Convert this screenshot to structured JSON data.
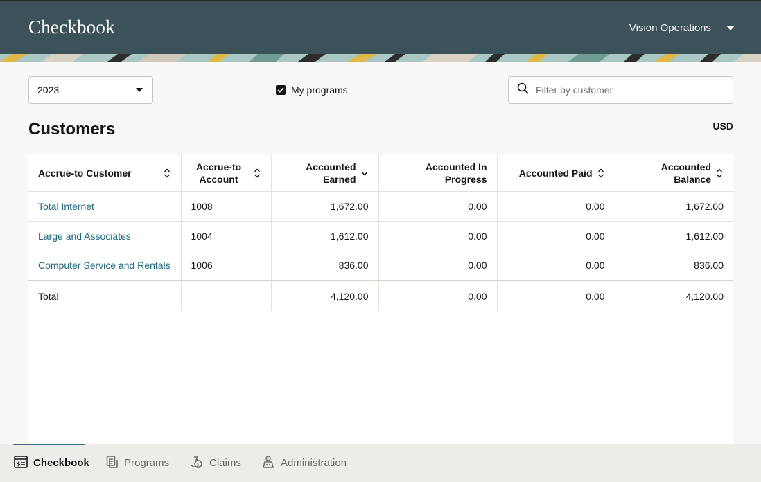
{
  "header": {
    "title": "Checkbook",
    "org": "Vision Operations"
  },
  "filters": {
    "year": "2023",
    "my_programs_label": "My programs",
    "my_programs_checked": true,
    "search_placeholder": "Filter by customer"
  },
  "section": {
    "title": "Customers",
    "currency": "USD"
  },
  "table": {
    "columns": [
      {
        "label": "Accrue-to Customer",
        "sort": "sortable"
      },
      {
        "label": "Accrue-to Account",
        "sort": "sortable"
      },
      {
        "label": "Accounted Earned",
        "sort": "descending"
      },
      {
        "label": "Accounted In Progress",
        "sort": "none"
      },
      {
        "label": "Accounted Paid",
        "sort": "sortable"
      },
      {
        "label": "Accounted Balance",
        "sort": "sortable"
      }
    ],
    "rows": [
      {
        "customer": "Total Internet",
        "account": "1008",
        "earned": "1,672.00",
        "in_progress": "0.00",
        "paid": "0.00",
        "balance": "1,672.00"
      },
      {
        "customer": "Large and Associates",
        "account": "1004",
        "earned": "1,612.00",
        "in_progress": "0.00",
        "paid": "0.00",
        "balance": "1,612.00"
      },
      {
        "customer": "Computer Service and Rentals",
        "account": "1006",
        "earned": "836.00",
        "in_progress": "0.00",
        "paid": "0.00",
        "balance": "836.00"
      }
    ],
    "total": {
      "label": "Total",
      "account": "",
      "earned": "4,120.00",
      "in_progress": "0.00",
      "paid": "0.00",
      "balance": "4,120.00"
    }
  },
  "bottom_nav": {
    "items": [
      {
        "label": "Checkbook",
        "icon": "checkbook-icon",
        "active": true
      },
      {
        "label": "Programs",
        "icon": "document-icon",
        "active": false
      },
      {
        "label": "Claims",
        "icon": "claims-icon",
        "active": false
      },
      {
        "label": "Administration",
        "icon": "administration-icon",
        "active": false
      }
    ]
  },
  "colors": {
    "header_bg": "#3b5258",
    "link": "#20677f",
    "accent": "#3b6e8a"
  }
}
